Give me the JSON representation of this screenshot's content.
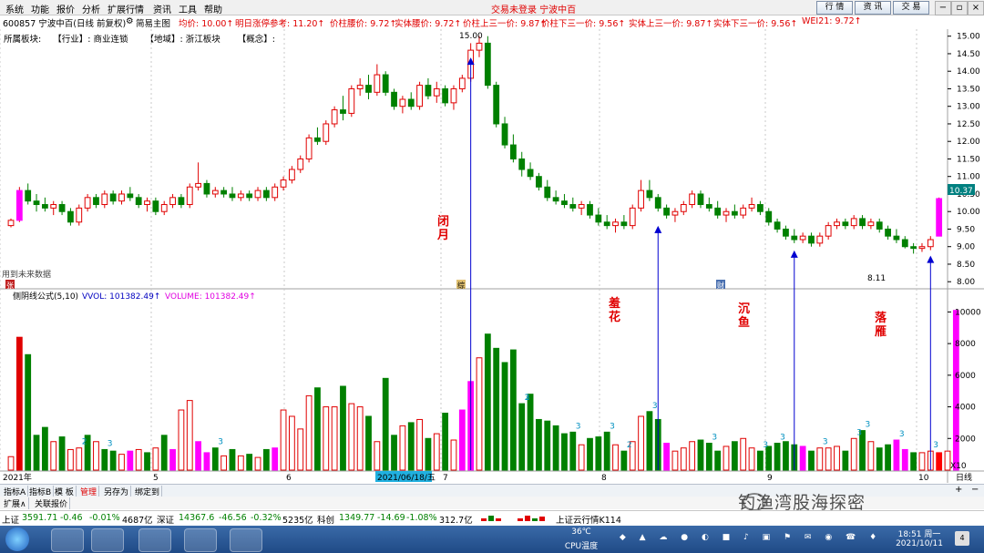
{
  "menu": {
    "items": [
      "系统",
      "功能",
      "报价",
      "分析",
      "扩展行情",
      "资讯",
      "工具",
      "帮助"
    ],
    "title": "交易未登录 宁波中百",
    "buttons": [
      "行 情",
      "资 讯",
      "交 易"
    ],
    "window_controls": [
      "−",
      "▫",
      "×"
    ]
  },
  "info": {
    "code": "600857 宁波中百(日线 前复权)",
    "indicator": "简易主图",
    "avg_price": "均价: 10.00↑",
    "next_limit": "明日涨停参考: 11.20↑",
    "box_waist": "价柱腰价: 9.72↑",
    "body_waist": "实体腰价: 9.72↑",
    "upper_third": "价柱上三一价: 9.87↑",
    "lower_third": "价柱下三一价: 9.56↑",
    "body_upper": "实体上三一价: 9.87↑",
    "body_lower": "实体下三一价: 9.56↑",
    "wei": "WEI21: 9.72↑"
  },
  "sector": {
    "label": "所属板块:",
    "industry": "【行业】: 商业连锁",
    "region": "【地域】: 浙江板块",
    "concept": "【概念】:"
  },
  "chart_data": {
    "type": "candlestick",
    "y_ticks": [
      "15.00",
      "14.50",
      "14.00",
      "13.50",
      "13.00",
      "12.50",
      "12.00",
      "11.50",
      "11.00",
      "10.50",
      "10.00",
      "9.50",
      "9.00",
      "8.50",
      "8.00"
    ],
    "ylim": [
      7.85,
      15.2
    ],
    "last_price": "10.37",
    "high_label": "15.00",
    "low_label": "8.11",
    "annotations": [
      {
        "text": "闭\n月",
        "x_idx": 54,
        "anchor_price": 14.6
      },
      {
        "text": "羞\n花",
        "x_idx": 76,
        "anchor_price": 9.8
      },
      {
        "text": "沉\n鱼",
        "x_idx": 92,
        "anchor_price": 9.1
      },
      {
        "text": "落\n雁",
        "x_idx": 108,
        "anchor_price": 8.95
      }
    ],
    "future_label": "用到未来数据",
    "markers": [
      "张",
      "综",
      "财"
    ],
    "volume_title": "侧阴线公式(5,10)",
    "vvol_label": "VVOL: 101382.49↑",
    "volume_label": "VOLUME: 101382.49↑",
    "volume_ticks": [
      "10000",
      "8000",
      "6000",
      "4000",
      "2000"
    ],
    "volume_scale": "X10",
    "x_labels": [
      "2021年",
      "5",
      "6",
      "7",
      "8",
      "9",
      "10"
    ],
    "x_highlight": "2021/06/18/五",
    "period": "日线",
    "candles": [
      [
        9.6,
        9.8,
        9.55,
        9.75
      ],
      [
        9.75,
        10.7,
        9.7,
        10.6
      ],
      [
        10.6,
        10.8,
        10.2,
        10.3
      ],
      [
        10.3,
        10.5,
        10.0,
        10.2
      ],
      [
        10.2,
        10.4,
        10.0,
        10.1
      ],
      [
        10.1,
        10.3,
        9.9,
        10.2
      ],
      [
        10.2,
        10.3,
        9.9,
        10.0
      ],
      [
        10.0,
        10.1,
        9.6,
        9.7
      ],
      [
        9.7,
        10.2,
        9.6,
        10.1
      ],
      [
        10.1,
        10.5,
        10.0,
        10.4
      ],
      [
        10.4,
        10.5,
        10.1,
        10.2
      ],
      [
        10.2,
        10.6,
        10.1,
        10.5
      ],
      [
        10.5,
        10.6,
        10.2,
        10.3
      ],
      [
        10.3,
        10.6,
        10.2,
        10.5
      ],
      [
        10.5,
        10.7,
        10.3,
        10.4
      ],
      [
        10.4,
        10.5,
        10.1,
        10.2
      ],
      [
        10.2,
        10.4,
        10.0,
        10.3
      ],
      [
        10.3,
        10.4,
        9.9,
        10.0
      ],
      [
        10.0,
        10.3,
        9.9,
        10.2
      ],
      [
        10.2,
        10.5,
        10.1,
        10.4
      ],
      [
        10.4,
        10.5,
        10.1,
        10.2
      ],
      [
        10.2,
        10.8,
        10.1,
        10.7
      ],
      [
        10.7,
        11.4,
        10.6,
        10.8
      ],
      [
        10.8,
        10.9,
        10.4,
        10.5
      ],
      [
        10.5,
        10.7,
        10.4,
        10.6
      ],
      [
        10.6,
        10.7,
        10.4,
        10.5
      ],
      [
        10.5,
        10.7,
        10.3,
        10.4
      ],
      [
        10.4,
        10.6,
        10.3,
        10.5
      ],
      [
        10.5,
        10.6,
        10.3,
        10.4
      ],
      [
        10.4,
        10.7,
        10.3,
        10.6
      ],
      [
        10.6,
        10.7,
        10.3,
        10.4
      ],
      [
        10.4,
        10.8,
        10.3,
        10.7
      ],
      [
        10.7,
        11.0,
        10.6,
        10.9
      ],
      [
        10.9,
        11.3,
        10.8,
        11.2
      ],
      [
        11.2,
        11.6,
        11.1,
        11.5
      ],
      [
        11.5,
        12.2,
        11.4,
        12.1
      ],
      [
        12.1,
        12.4,
        11.9,
        12.0
      ],
      [
        12.0,
        12.6,
        11.9,
        12.5
      ],
      [
        12.5,
        13.0,
        12.4,
        12.9
      ],
      [
        12.9,
        13.3,
        12.6,
        12.8
      ],
      [
        12.8,
        13.6,
        12.7,
        13.5
      ],
      [
        13.5,
        13.8,
        13.3,
        13.6
      ],
      [
        13.6,
        13.9,
        13.2,
        13.4
      ],
      [
        13.4,
        14.2,
        13.3,
        13.9
      ],
      [
        13.9,
        14.0,
        13.3,
        13.4
      ],
      [
        13.4,
        13.5,
        12.9,
        13.0
      ],
      [
        13.0,
        13.3,
        12.8,
        13.2
      ],
      [
        13.2,
        13.4,
        12.9,
        13.0
      ],
      [
        13.0,
        13.7,
        12.9,
        13.6
      ],
      [
        13.6,
        13.8,
        13.2,
        13.3
      ],
      [
        13.3,
        13.7,
        13.1,
        13.5
      ],
      [
        13.5,
        13.6,
        13.0,
        13.1
      ],
      [
        13.1,
        13.6,
        12.9,
        13.5
      ],
      [
        13.5,
        13.9,
        13.4,
        13.8
      ],
      [
        13.8,
        14.8,
        13.7,
        14.6
      ],
      [
        14.6,
        15.0,
        14.4,
        14.8
      ],
      [
        14.8,
        15.0,
        13.5,
        13.6
      ],
      [
        13.6,
        13.7,
        12.4,
        12.5
      ],
      [
        12.5,
        12.7,
        11.8,
        11.9
      ],
      [
        11.9,
        12.2,
        11.4,
        11.5
      ],
      [
        11.5,
        11.7,
        11.0,
        11.2
      ],
      [
        11.2,
        11.4,
        10.9,
        11.0
      ],
      [
        11.0,
        11.1,
        10.6,
        10.7
      ],
      [
        10.7,
        10.9,
        10.3,
        10.4
      ],
      [
        10.4,
        10.6,
        10.2,
        10.3
      ],
      [
        10.3,
        10.5,
        10.1,
        10.2
      ],
      [
        10.2,
        10.4,
        10.0,
        10.1
      ],
      [
        10.1,
        10.3,
        9.9,
        10.2
      ],
      [
        10.2,
        10.3,
        9.8,
        9.9
      ],
      [
        9.9,
        10.1,
        9.6,
        9.7
      ],
      [
        9.7,
        9.9,
        9.5,
        9.6
      ],
      [
        9.6,
        9.8,
        9.4,
        9.7
      ],
      [
        9.7,
        9.9,
        9.5,
        9.6
      ],
      [
        9.6,
        10.2,
        9.5,
        10.1
      ],
      [
        10.1,
        10.9,
        10.0,
        10.6
      ],
      [
        10.6,
        10.9,
        10.3,
        10.4
      ],
      [
        10.4,
        10.5,
        10.0,
        10.1
      ],
      [
        10.1,
        10.2,
        9.8,
        9.9
      ],
      [
        9.9,
        10.1,
        9.7,
        10.0
      ],
      [
        10.0,
        10.3,
        9.9,
        10.2
      ],
      [
        10.2,
        10.6,
        10.1,
        10.5
      ],
      [
        10.5,
        10.6,
        10.1,
        10.2
      ],
      [
        10.2,
        10.4,
        10.0,
        10.1
      ],
      [
        10.1,
        10.3,
        9.8,
        9.9
      ],
      [
        9.9,
        10.1,
        9.7,
        10.0
      ],
      [
        10.0,
        10.2,
        9.8,
        9.9
      ],
      [
        9.9,
        10.2,
        9.8,
        10.1
      ],
      [
        10.1,
        10.4,
        10.0,
        10.2
      ],
      [
        10.2,
        10.3,
        9.9,
        10.0
      ],
      [
        10.0,
        10.1,
        9.6,
        9.7
      ],
      [
        9.7,
        9.8,
        9.4,
        9.5
      ],
      [
        9.5,
        9.6,
        9.2,
        9.3
      ],
      [
        9.3,
        9.5,
        9.1,
        9.2
      ],
      [
        9.2,
        9.4,
        9.1,
        9.3
      ],
      [
        9.3,
        9.4,
        9.0,
        9.1
      ],
      [
        9.1,
        9.4,
        9.0,
        9.3
      ],
      [
        9.3,
        9.7,
        9.2,
        9.6
      ],
      [
        9.6,
        9.8,
        9.5,
        9.7
      ],
      [
        9.7,
        9.8,
        9.5,
        9.6
      ],
      [
        9.6,
        9.9,
        9.5,
        9.8
      ],
      [
        9.8,
        9.9,
        9.5,
        9.6
      ],
      [
        9.6,
        9.8,
        9.5,
        9.7
      ],
      [
        9.7,
        9.8,
        9.4,
        9.5
      ],
      [
        9.5,
        9.6,
        9.2,
        9.3
      ],
      [
        9.3,
        9.5,
        9.1,
        9.2
      ],
      [
        9.2,
        9.3,
        8.95,
        9.0
      ],
      [
        9.0,
        9.1,
        8.8,
        8.95
      ],
      [
        8.95,
        9.1,
        8.85,
        9.0
      ],
      [
        9.0,
        9.3,
        8.9,
        9.2
      ],
      [
        9.3,
        10.4,
        9.3,
        10.37
      ]
    ],
    "volumes": [
      850,
      8400,
      7300,
      2200,
      2700,
      1800,
      2100,
      1300,
      1400,
      2200,
      1800,
      1300,
      1200,
      1000,
      1200,
      1300,
      1100,
      1400,
      2200,
      1300,
      3800,
      4400,
      1800,
      1100,
      1400,
      900,
      1300,
      900,
      1000,
      800,
      1300,
      1400,
      3800,
      3400,
      2600,
      4700,
      5200,
      4000,
      4000,
      5300,
      4200,
      4000,
      3400,
      1800,
      5800,
      2200,
      2800,
      3000,
      3200,
      2000,
      2300,
      3600,
      1900,
      3800,
      5600,
      7100,
      8600,
      7700,
      6800,
      7600,
      4200,
      4800,
      3200,
      3100,
      2800,
      2300,
      2400,
      1600,
      2000,
      2100,
      2400,
      1600,
      1200,
      1800,
      3400,
      3700,
      3200,
      1700,
      1200,
      1400,
      1800,
      1900,
      1700,
      1200,
      1500,
      1800,
      2000,
      1400,
      1200,
      1500,
      1700,
      1800,
      1600,
      1500,
      1200,
      1400,
      1400,
      1500,
      1200,
      2000,
      2500,
      1800,
      1400,
      1600,
      1900,
      1300,
      1100,
      1100,
      1200,
      1100,
      1200,
      10100
    ],
    "volume_up": [
      1,
      1,
      0,
      0,
      0,
      1,
      0,
      1,
      1,
      0,
      1,
      0,
      0,
      1,
      0,
      1,
      0,
      1,
      0,
      0,
      1,
      1,
      0,
      1,
      0,
      1,
      0,
      1,
      0,
      1,
      0,
      1,
      1,
      1,
      1,
      1,
      0,
      1,
      1,
      0,
      1,
      1,
      0,
      1,
      0,
      0,
      1,
      0,
      1,
      0,
      1,
      0,
      1,
      1,
      1,
      1,
      0,
      0,
      0,
      0,
      0,
      0,
      0,
      0,
      0,
      0,
      0,
      1,
      0,
      0,
      0,
      1,
      0,
      1,
      1,
      0,
      0,
      0,
      1,
      1,
      1,
      0,
      0,
      0,
      1,
      0,
      1,
      1,
      0,
      0,
      0,
      0,
      0,
      1,
      0,
      1,
      1,
      1,
      0,
      1,
      0,
      1,
      0,
      0,
      0,
      0,
      0,
      1,
      1,
      1,
      1,
      1
    ],
    "volume_magenta": [
      14,
      19,
      22,
      23,
      31,
      53,
      54,
      77,
      93,
      104,
      105,
      111
    ],
    "volume_markers": [
      "2",
      "3",
      "3",
      "2",
      "3",
      "3",
      "3",
      "3",
      "3",
      "3",
      "3",
      "3",
      "3",
      "3",
      "2",
      "3",
      "3"
    ],
    "colors": {
      "up": "#e00000",
      "down": "#008000",
      "magenta": "#ff00ff",
      "arrow": "#0000d0",
      "annotation": "#e00000"
    }
  },
  "bottom_tabs": [
    "指标A",
    "指标B",
    "模 板",
    "管理",
    "另存为",
    "绑定到"
  ],
  "ext_tabs": [
    "扩展∧",
    "关联报价"
  ],
  "status": {
    "sh": "上证",
    "sh_val": "3591.71",
    "sh_chg": "-0.46",
    "sh_pct": "-0.01%",
    "sh_amt": "4687亿",
    "sz": "深证",
    "sz_val": "14367.6",
    "sz_chg": "-46.56",
    "sz_pct": "-0.32%",
    "sz_amt": "5235亿",
    "kc": "科创",
    "kc_val": "1349.77",
    "kc_chg": "-14.69",
    "kc_pct": "-1.08%",
    "kc_amt": "312.7亿",
    "cloud": "上证云行情K114"
  },
  "taskbar": {
    "temp": "36℃",
    "cpu": "CPU温度",
    "time": "18:51 周一",
    "date": "2021/10/11",
    "badge": "4"
  },
  "watermark": "钓渔湾股海探密"
}
